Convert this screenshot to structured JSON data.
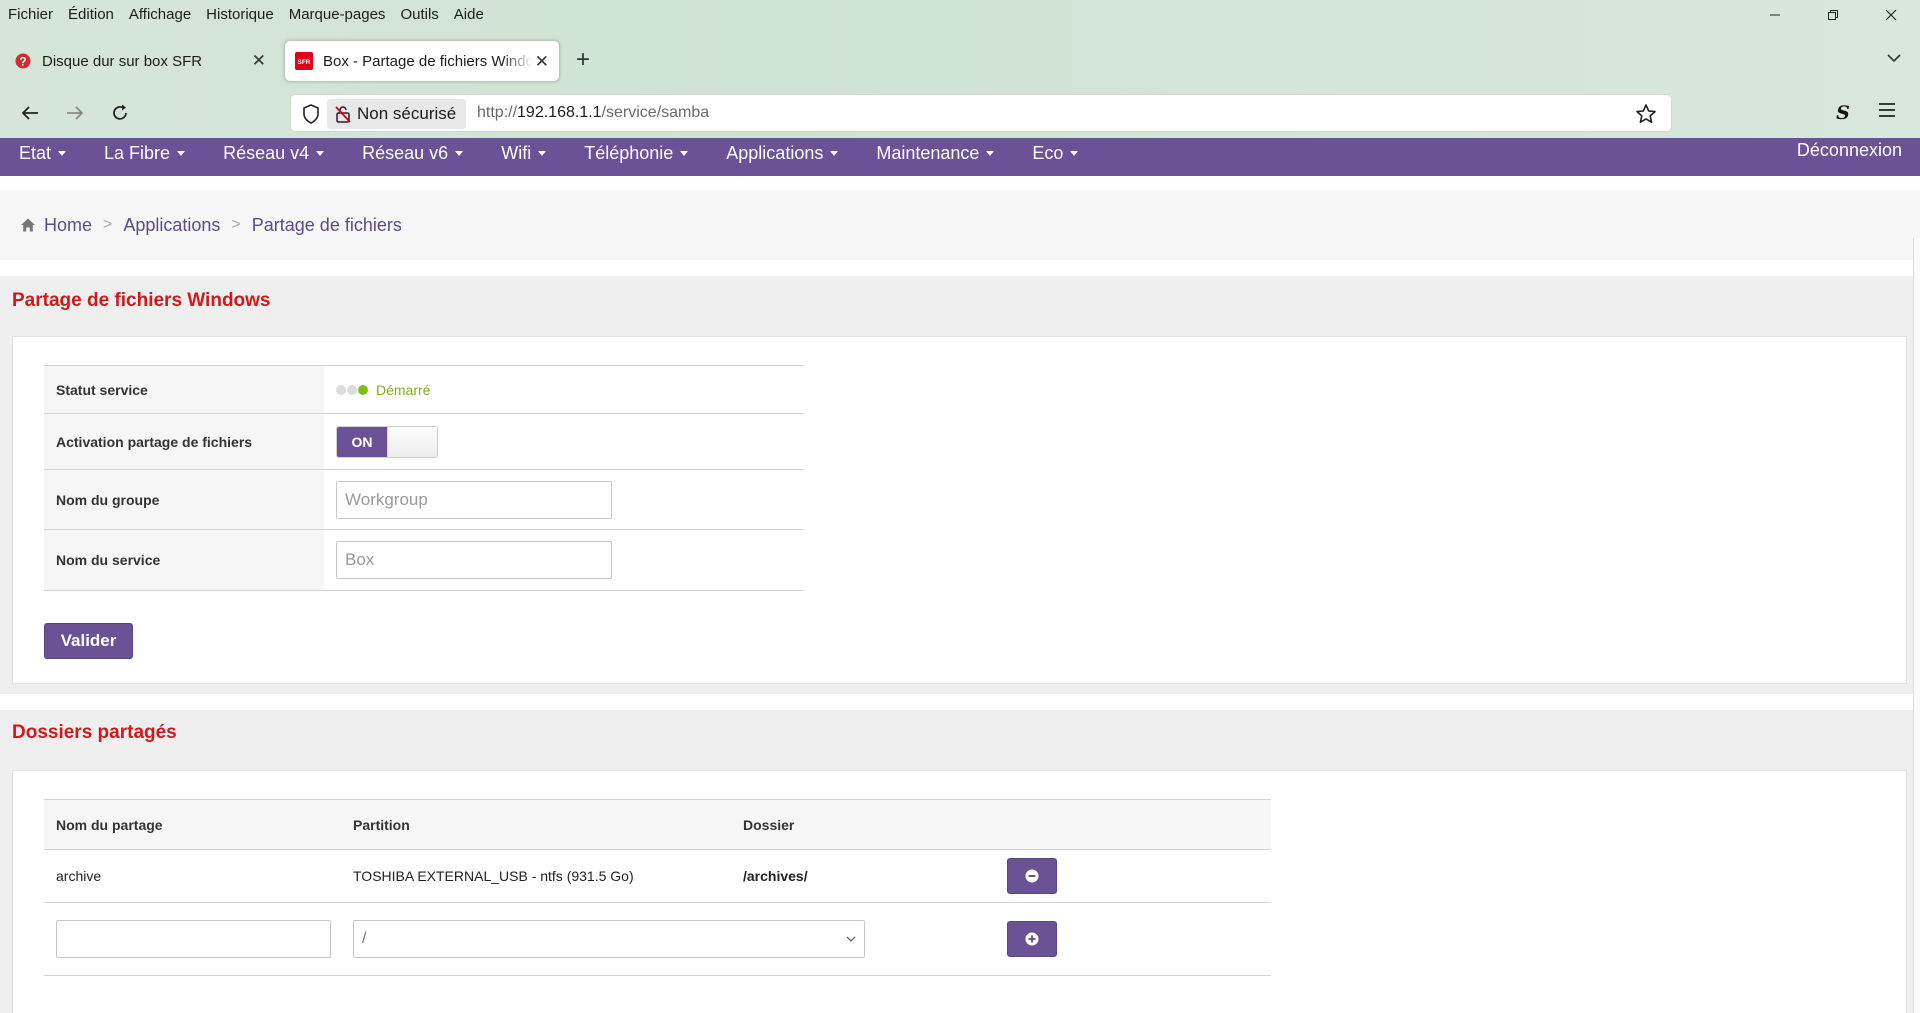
{
  "browser": {
    "menu": [
      "Fichier",
      "Édition",
      "Affichage",
      "Historique",
      "Marque-pages",
      "Outils",
      "Aide"
    ],
    "tabs": [
      {
        "title": "Disque dur sur box SFR",
        "active": false
      },
      {
        "title": "Box - Partage de fichiers Windows",
        "active": true
      }
    ],
    "not_secure": "Non sécurisé",
    "url_scheme": "http://",
    "url_host": "192.168.1.1",
    "url_path": "/service/samba",
    "extension_letter": "S"
  },
  "nav": {
    "items": [
      "Etat",
      "La Fibre",
      "Réseau v4",
      "Réseau v6",
      "Wifi",
      "Téléphonie",
      "Applications",
      "Maintenance",
      "Eco"
    ],
    "logout": "Déconnexion"
  },
  "breadcrumb": [
    "Home",
    "Applications",
    "Partage de fichiers"
  ],
  "samba": {
    "title": "Partage de fichiers Windows",
    "rows": {
      "status_label": "Statut service",
      "status_value": "Démarré",
      "activation_label": "Activation partage de fichiers",
      "toggle_value": "ON",
      "group_label": "Nom du groupe",
      "group_placeholder": "Workgroup",
      "service_label": "Nom du service",
      "service_placeholder": "Box"
    },
    "submit": "Valider"
  },
  "shares": {
    "title": "Dossiers partagés",
    "columns": [
      "Nom du partage",
      "Partition",
      "Dossier"
    ],
    "rows": [
      {
        "name": "archive",
        "partition": "TOSHIBA EXTERNAL_USB - ntfs (931.5 Go)",
        "folder": "/archives/"
      }
    ],
    "new_row": {
      "name_value": "",
      "partition_value": "/"
    }
  },
  "colors": {
    "accent": "#6b5297",
    "title_red": "#d0191b",
    "status_green": "#7fae17"
  }
}
